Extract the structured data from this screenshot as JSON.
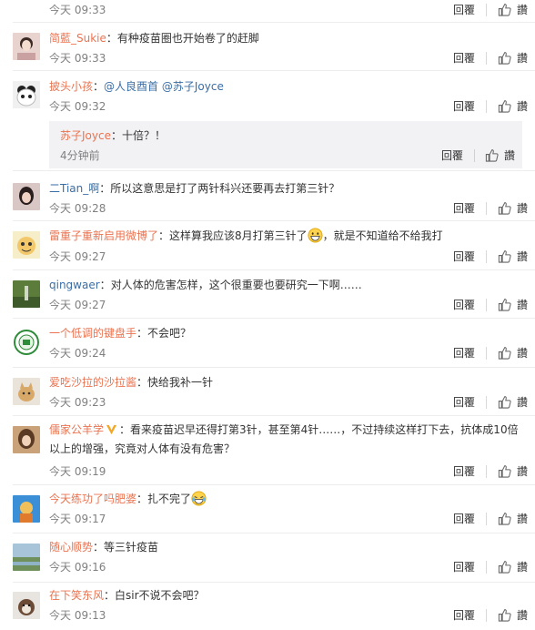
{
  "ui": {
    "reply": "回覆",
    "like": "讚",
    "sep": "："
  },
  "comments": [
    {
      "time": "今天 09:33"
    },
    {
      "user": "简藍_Sukie",
      "text": "有种疫苗圈也开始卷了的赶脚",
      "time": "今天 09:33"
    },
    {
      "user": "披头小孩",
      "mentions": [
        "@人良酉首",
        "@苏子Joyce"
      ],
      "time": "今天 09:32",
      "reply_box": {
        "user": "苏子Joyce",
        "text": "十倍？！",
        "time": "4分钟前"
      }
    },
    {
      "user": "二Tian_啊",
      "text": "所以这意思是打了两针科兴还要再去打第三针？",
      "time": "今天 09:28"
    },
    {
      "user": "雷重子重新启用微博了",
      "text": "这样算我应该8月打第三针了",
      "text2": "，就是不知道给不给我打",
      "time": "今天 09:27"
    },
    {
      "user": "qingwaer",
      "text": "对人体的危害怎样，这个很重要也要研究一下啊……",
      "time": "今天 09:27"
    },
    {
      "user": "一个低调的键盘手",
      "text": "不会吧？",
      "time": "今天 09:24"
    },
    {
      "user": "爱吃沙拉的沙拉酱",
      "text": "快给我补一针",
      "time": "今天 09:23"
    },
    {
      "user": "儒家公羊学",
      "text": "看来疫苗迟早还得打第3针，甚至第4针……，不过持续这样打下去，抗体成10倍以上的增强，究竟对人体有没有危害？",
      "time": "今天 09:19"
    },
    {
      "user": "今天练功了吗肥婆",
      "text": "扎不完了",
      "time": "今天 09:17"
    },
    {
      "user": "随心顺势",
      "text": "等三针疫苗",
      "time": "今天 09:16"
    },
    {
      "user": "在下笑东风",
      "text": "白sir不说不会吧？",
      "time": "今天 09:13"
    }
  ],
  "colors": {
    "username": "#eb7350",
    "mention": "#3a6ea5",
    "time": "#808080",
    "reply_bg": "#f2f2f5"
  },
  "icons": {
    "like": "thumbs-up-icon",
    "verified": "v-badge-icon",
    "emoji_grin": "grinning-emoji",
    "emoji_lol": "laughing-tears-emoji"
  }
}
